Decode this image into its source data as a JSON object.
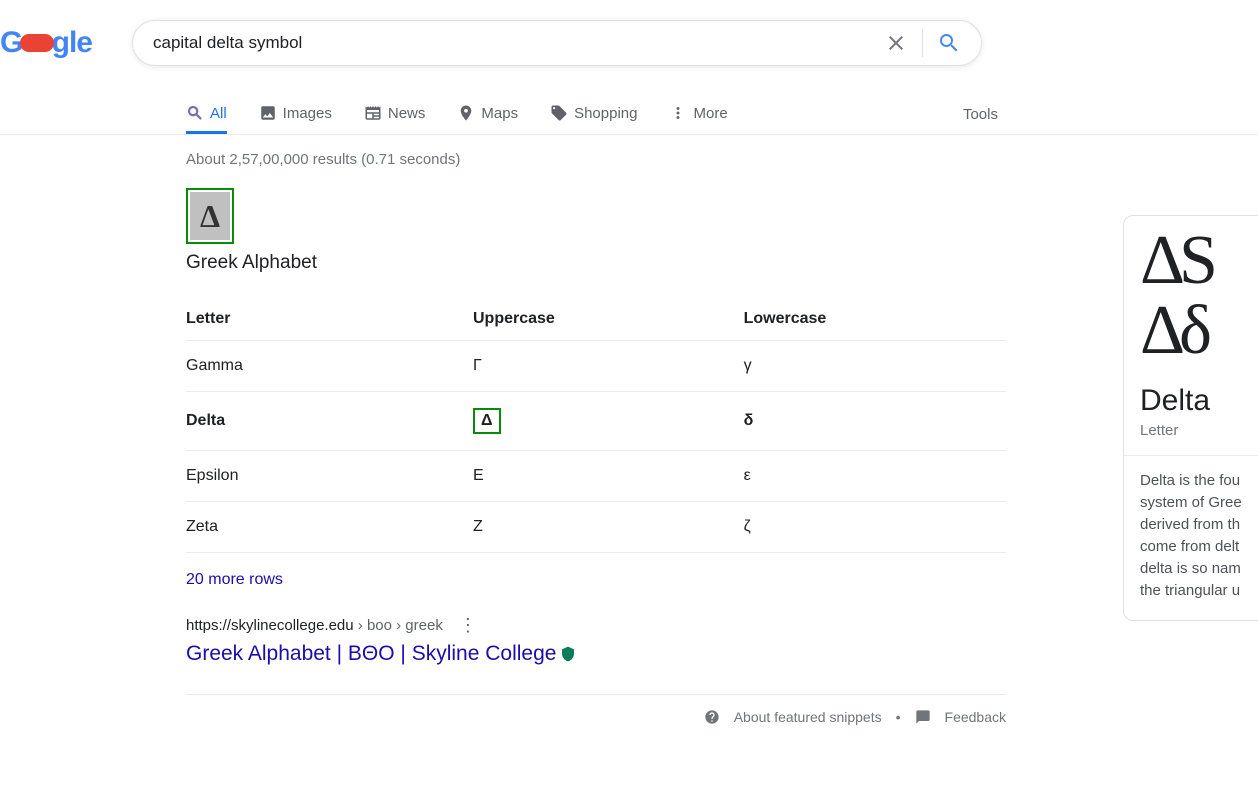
{
  "search": {
    "query": "capital delta symbol"
  },
  "tabs": {
    "all": "All",
    "images": "Images",
    "news": "News",
    "maps": "Maps",
    "shopping": "Shopping",
    "more": "More",
    "tools": "Tools"
  },
  "stats": "About 2,57,00,000 results (0.71 seconds)",
  "featured": {
    "thumb_glyph": "Δ",
    "title": "Greek Alphabet",
    "headers": [
      "Letter",
      "Uppercase",
      "Lowercase"
    ],
    "rows": [
      {
        "letter": "Gamma",
        "upper": "Γ",
        "lower": "γ",
        "highlight": false
      },
      {
        "letter": "Delta",
        "upper": "Δ",
        "lower": "δ",
        "highlight": true
      },
      {
        "letter": "Epsilon",
        "upper": "Ε",
        "lower": "ε",
        "highlight": false
      },
      {
        "letter": "Zeta",
        "upper": "Ζ",
        "lower": "ζ",
        "highlight": false
      }
    ],
    "more_rows": "20 more rows"
  },
  "result": {
    "cite_host": "https://skylinecollege.edu",
    "cite_path": " › boo › greek",
    "title": "Greek Alphabet | ΒΘΟ | Skyline College"
  },
  "footer": {
    "about": "About featured snippets",
    "feedback": "Feedback"
  },
  "kp": {
    "row1": "ΔS",
    "row2": "Δδ",
    "title": "Delta",
    "sub": "Letter",
    "desc": "Delta is the fou system of Gree derived from th come from delt delta is so nam the triangular u"
  }
}
